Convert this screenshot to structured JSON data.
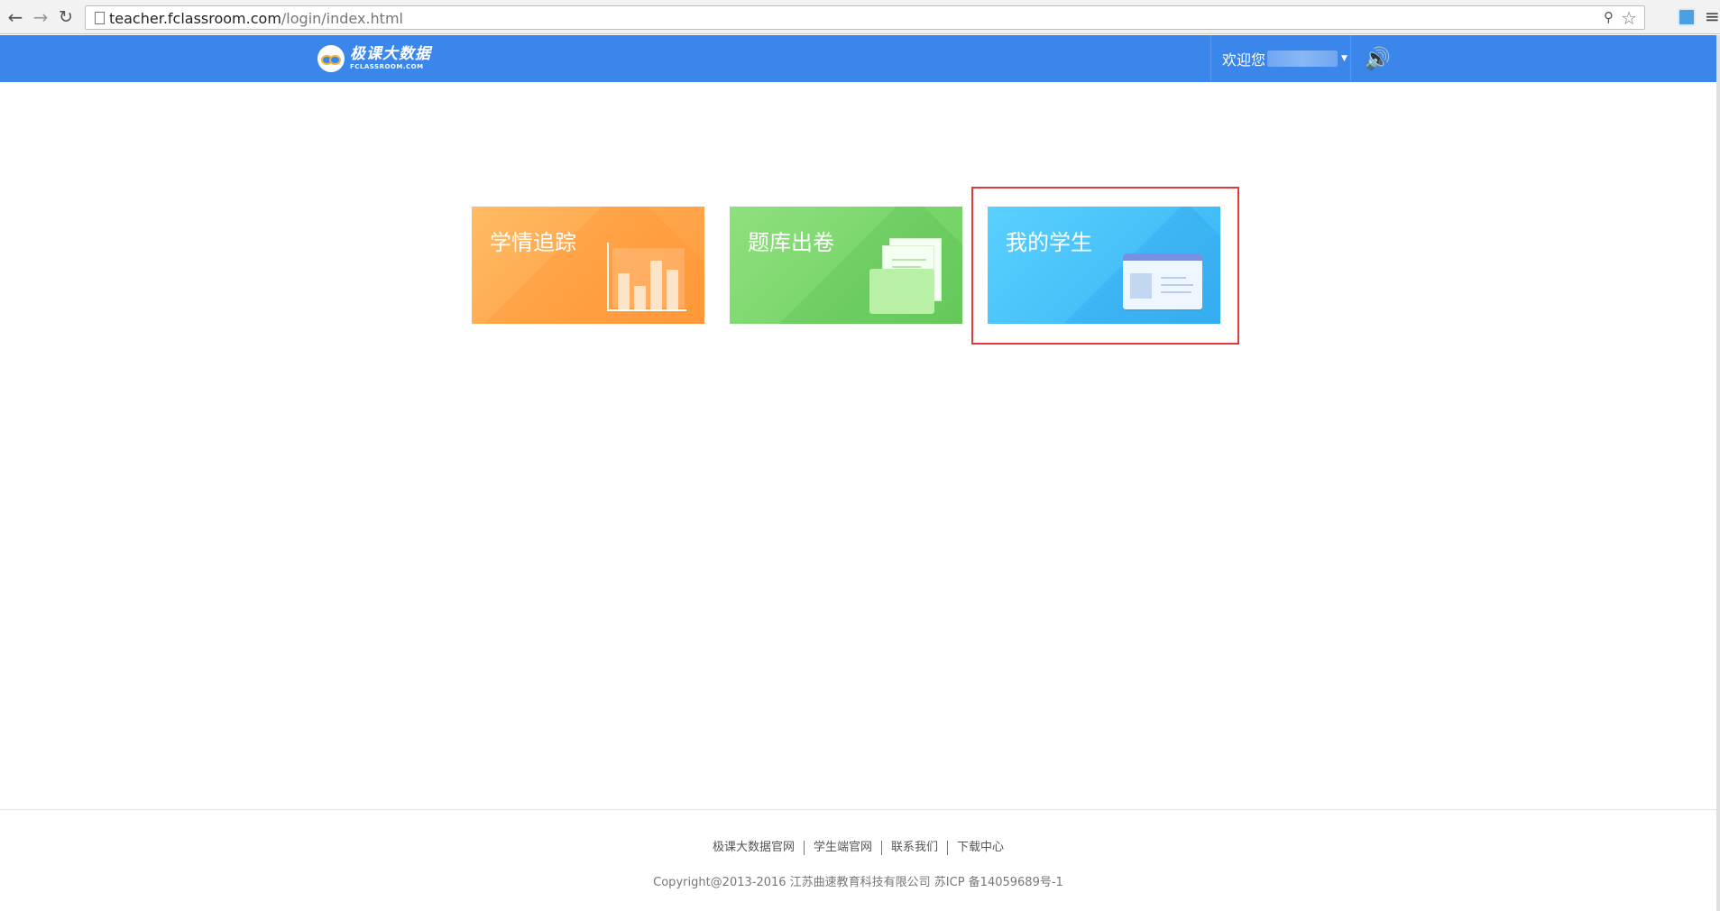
{
  "browser": {
    "url_host": "teacher.fclassroom.com",
    "url_path": "/login/index.html"
  },
  "header": {
    "logo_name": "极课大数据",
    "logo_domain": "FCLASSROOM.COM",
    "welcome_label": "欢迎您",
    "accent_color": "#3b86ea"
  },
  "tiles": [
    {
      "title": "学情追踪",
      "icon": "bar-chart-icon",
      "color": "#ffab50"
    },
    {
      "title": "题库出卷",
      "icon": "folder-icon",
      "color": "#7ad76b"
    },
    {
      "title": "我的学生",
      "icon": "id-card-icon",
      "color": "#48c3fa"
    }
  ],
  "footer": {
    "links": [
      "极课大数据官网",
      "学生端官网",
      "联系我们",
      "下载中心"
    ],
    "copyright": "Copyright@2013-2016 江苏曲速教育科技有限公司 苏ICP 备14059689号-1"
  }
}
